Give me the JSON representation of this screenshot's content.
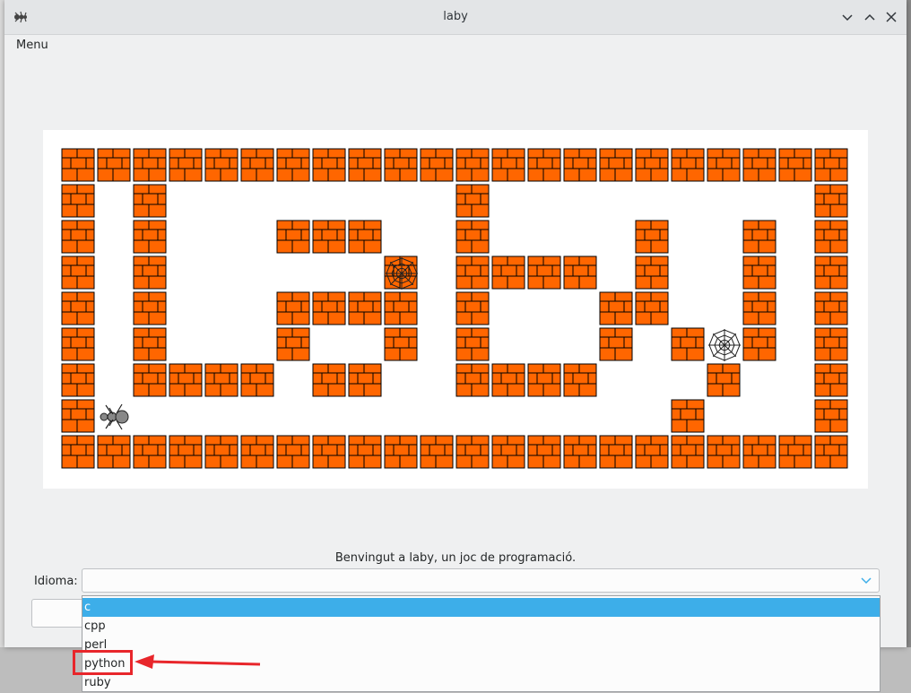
{
  "window": {
    "title": "laby"
  },
  "menubar": {
    "menu_label": "Menu"
  },
  "status": {
    "welcome_text": "Benvingut a laby, un joc de programació."
  },
  "language": {
    "label": "Idioma:",
    "current_value": "",
    "options": [
      "c",
      "cpp",
      "perl",
      "python",
      "ruby"
    ],
    "highlighted_index": 0,
    "annotated_option": "python"
  },
  "maze": {
    "rows": [
      "############################################",
      "#  #          #          #              #",
      "#  #      ###  #        #  #            #",
      "#  #       W#  ####     #  #            #",
      "#  #     ###   #   #    #  #            #",
      "#  #     #  #  #   #     W #            #",
      "#  ####   ##   ####      #              #",
      "# A                      #              #",
      "############################################"
    ],
    "grid": [
      "########################################",
      "",
      "",
      "",
      "",
      "",
      "",
      "",
      ""
    ],
    "colors": {
      "brick": "#ff6600",
      "mortar": "#000000",
      "background": "#ffffff"
    }
  }
}
